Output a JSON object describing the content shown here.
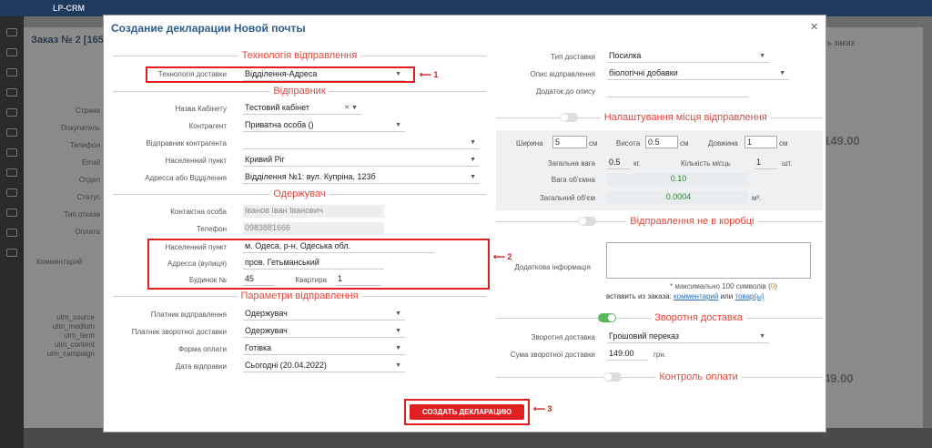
{
  "app": {
    "logo": "LP-CRM",
    "order_title": "Заказ № 2 [165"
  },
  "bg": {
    "left_labels": [
      "Страна",
      "Покупатель",
      "Телефон",
      "Email",
      "Отдел",
      "Статус",
      "Тип отказа",
      "Оплата"
    ],
    "comment_label": "Комментарий",
    "utm": [
      "utm_source",
      "utm_medium",
      "utm_term",
      "utm_content",
      "utm_campaign"
    ],
    "right_text": "ть заказ",
    "price1": "149.00",
    "price2": "49.00"
  },
  "modal": {
    "title": "Создание декларации Новой почты",
    "close": "×",
    "sections": {
      "tech": "Технологія відправлення",
      "sender": "Відправник",
      "receiver": "Одержувач",
      "params": "Параметри відправлення",
      "place": "Налаштування місця відправлення",
      "not_box": "Відправлення не в коробці",
      "return": "Зворотня доставка",
      "control": "Контроль оплати"
    },
    "left": {
      "delivery_tech_label": "Технологія доставки",
      "delivery_tech_value": "Відділення-Адреса",
      "cabinet_label": "Назва Кабінету",
      "cabinet_value": "Тестовий кабінет",
      "counterparty_label": "Контрагент",
      "counterparty_value": "Приватна особа ()",
      "sender_contragent_label": "Відправник контрагента",
      "sender_contragent_value": "",
      "city_label": "Населенний пункт",
      "city_value": "Кривий Ріг",
      "address_label": "Адресса або Відділення",
      "address_value": "Відділення №1: вул. Купріна, 123б",
      "contact_label": "Контактна особа",
      "contact_value": "Іванов Іван Іванович",
      "phone_label": "Телефон",
      "phone_value": "0983881666",
      "rcity_label": "Населенний пункт",
      "rcity_value": "м. Одеса,  р-н, Одеська обл.",
      "street_label": "Адресса (вулиця)",
      "street_value": "пров. Гетьманський",
      "house_label": "Будинок №",
      "house_value": "45",
      "flat_label": "Квартира",
      "flat_value": "1",
      "payer_label": "Платник відправлення",
      "payer_value": "Одержувач",
      "return_payer_label": "Платник зворотної доставки",
      "return_payer_value": "Одержувач",
      "pay_form_label": "Форма оплати",
      "pay_form_value": "Готівка",
      "send_date_label": "Дата відправки",
      "send_date_value": "Сьогодні (20.04.2022)"
    },
    "right": {
      "delivery_type_label": "Тип доставки",
      "delivery_type_value": "Посилка",
      "desc_label": "Опис відправлення",
      "desc_value": "біологічні добавки",
      "desc_add_label": "Додаток до опису",
      "width_label": "Ширина",
      "width_value": "5",
      "height_label": "Висота",
      "height_value": "0.5",
      "length_label": "Довжина",
      "length_value": "1",
      "cm": "см",
      "total_weight_label": "Загальна вага",
      "total_weight_value": "0.5",
      "kg": "кг.",
      "places_label": "Кількість місць",
      "places_value": "1",
      "pcs": "шт.",
      "vol_weight_label": "Вага об'ємна",
      "vol_weight_value": "0.10",
      "total_vol_label": "Загальний об'єм",
      "total_vol_value": "0.0004",
      "m3": "м³.",
      "extra_info_label": "Додаткова інформація",
      "max_hint_prefix": "* максимально 100 символів (",
      "max_hint_count": "0",
      "max_hint_suffix": ")",
      "insert_prefix": "вставить из заказа: ",
      "insert_comments": "комментарий",
      "insert_or": " или ",
      "insert_goods": "товар(ы)",
      "return_delivery_label": "Зворотня доставка",
      "return_delivery_value": "Грошовий переказ",
      "return_sum_label": "Сума зворотної доставки",
      "return_sum_value": "149.00",
      "uah": "грн."
    },
    "create_button": "СОЗДАТЬ ДЕКЛАРАЦИЮ",
    "markers": [
      "1",
      "2",
      "3"
    ]
  },
  "colors": {
    "accent": "#e3463c",
    "title": "#2d5f8f",
    "marker": "#e02020"
  }
}
